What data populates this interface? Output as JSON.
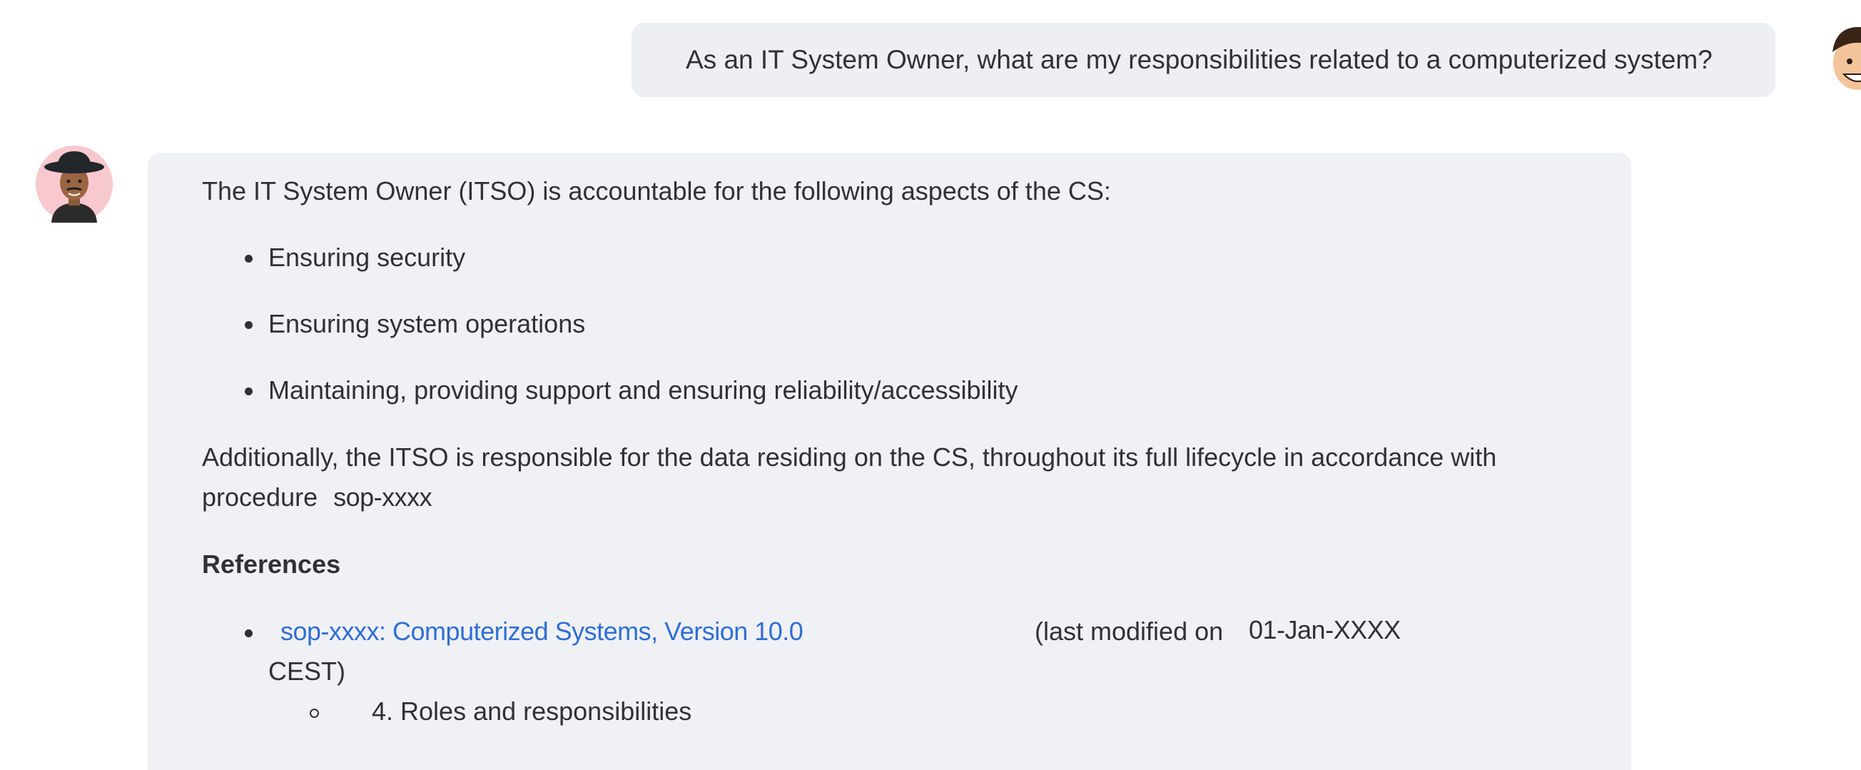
{
  "user_message": {
    "text": "As an IT System Owner, what are my responsibilities related to a computerized system?"
  },
  "assistant_message": {
    "intro": "The IT System Owner (ITSO) is accountable for the following aspects of the CS:",
    "bullets": [
      "Ensuring security",
      "Ensuring system operations",
      "Maintaining, providing support and ensuring reliability/accessibility"
    ],
    "paragraph_line1": "Additionally, the ITSO is responsible for the data residing on the CS, throughout its full lifecycle in accordance with",
    "paragraph_line2_prefix": "procedure",
    "paragraph_sop": "sop-xxxx",
    "references_heading": "References",
    "reference": {
      "link_text": "sop-xxxx: Computerized Systems, Version 10.0",
      "modified_prefix": "(last modified on",
      "modified_date": "01-Jan-XXXX",
      "modified_suffix": "CEST)",
      "sub_item": "4. Roles and responsibilities"
    }
  },
  "colors": {
    "bubble_bg": "#eeeff3",
    "link": "#2f6ed6",
    "text": "#2f3136"
  }
}
